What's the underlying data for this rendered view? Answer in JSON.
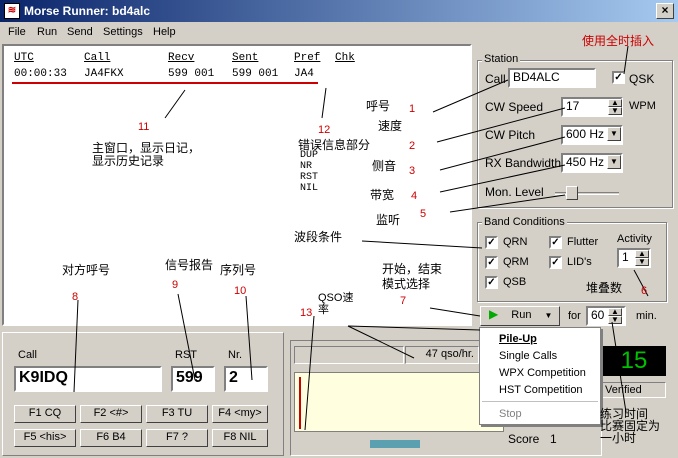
{
  "window": {
    "title": "Morse Runner:  bd4alc",
    "close": "×"
  },
  "menu": [
    "File",
    "Run",
    "Send",
    "Settings",
    "Help"
  ],
  "log": {
    "headers": [
      "UTC",
      "Call",
      "Recv",
      "Sent",
      "Pref",
      "Chk"
    ],
    "row": [
      "00:00:33",
      "JA4FKX",
      "599 001",
      "599 001",
      "JA4",
      ""
    ]
  },
  "station": {
    "title": "Station",
    "call_label": "Call",
    "call_value": "BD4ALC",
    "qsk_label": "QSK",
    "qsk_checked": true,
    "wpm_label": "CW Speed",
    "wpm_value": "17",
    "wpm_unit": "WPM",
    "pitch_label": "CW Pitch",
    "pitch_value": "600 Hz",
    "bw_label": "RX Bandwidth",
    "bw_value": "450 Hz",
    "mon_label": "Mon. Level"
  },
  "band": {
    "title": "Band Conditions",
    "qrn": "QRN",
    "qrm": "QRM",
    "qsb": "QSB",
    "flutter": "Flutter",
    "lids": "LID's",
    "activity_label": "Activity",
    "activity_value": "1"
  },
  "run": {
    "button": "Run",
    "for_label": "for",
    "minutes": "60",
    "min_label": "min."
  },
  "dropdown": [
    "Pile-Up",
    "Single Calls",
    "WPX Competition",
    "HST Competition",
    "Stop"
  ],
  "entry": {
    "call_label": "Call",
    "call_value": "K9IDQ",
    "rst_label": "RST",
    "rst_value": "599",
    "nr_label": "Nr.",
    "nr_value": "2",
    "fkeys": [
      "F1  CQ",
      "F2 <#>",
      "F3  TU",
      "F4 <my>",
      "F5 <his>",
      "F6  B4",
      "F7  ?",
      "F8  NIL"
    ]
  },
  "stats": {
    "rate": "47  qso/hr.",
    "big_number": "15",
    "verified": "Verified",
    "score_label": "Score",
    "score_value": "1"
  },
  "annotations": {
    "qsk_note": "使用全时插入",
    "callsign": "呼号",
    "speed": "速度",
    "errors": "错误信息部分",
    "err_list": [
      "DUP",
      "NR",
      "RST",
      "NIL"
    ],
    "pitch": "侧音",
    "bandwidth": "带宽",
    "monitor": "监听",
    "main_window": "主窗口，显示日记，\n显示历史记录",
    "band_cond": "波段条件",
    "activity": "堆叠数",
    "start_stop": "开始，结束\n模式选择",
    "their_call": "对方呼号",
    "signal_report": "信号报告",
    "serial": "序列号",
    "qso_rate": "QSO速\n率",
    "practice_time": "练习时间\n比赛固定为\n一小时",
    "nums": [
      "1",
      "2",
      "3",
      "4",
      "5",
      "6",
      "7",
      "8",
      "9",
      "10",
      "11",
      "12",
      "13"
    ]
  },
  "colors": {
    "title_start": "#0a246a",
    "annotation_red": "#cc0000",
    "big_number": "#00ff00"
  }
}
